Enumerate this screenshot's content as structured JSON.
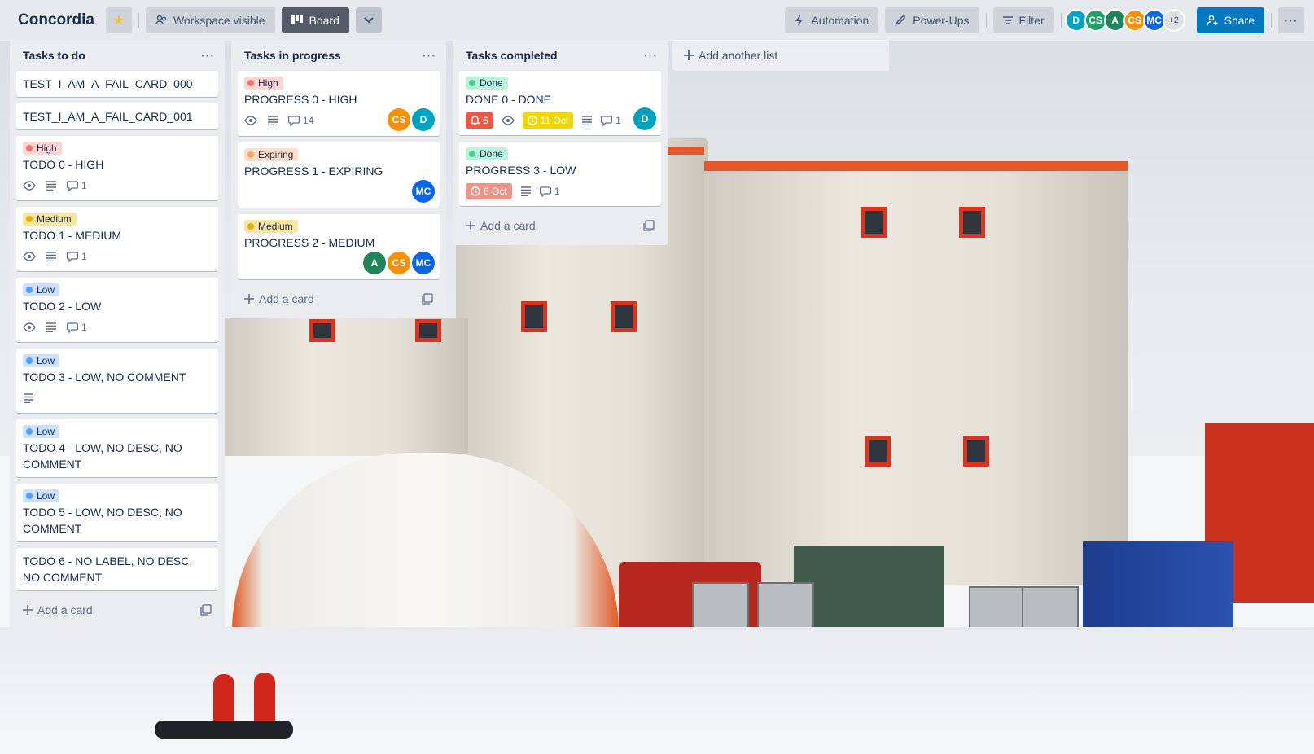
{
  "header": {
    "board_title": "Concordia",
    "workspace_visible": "Workspace visible",
    "board_view": "Board",
    "automation": "Automation",
    "power_ups": "Power-Ups",
    "filter": "Filter",
    "share": "Share",
    "members": [
      {
        "initials": "D",
        "color": "#00a3bf"
      },
      {
        "initials": "CS",
        "color": "#22a06b"
      },
      {
        "initials": "A",
        "color": "#1f845a"
      },
      {
        "initials": "CS",
        "color": "#f79009"
      },
      {
        "initials": "MC",
        "color": "#0c66e4"
      }
    ],
    "more_members": "+2"
  },
  "lists": [
    {
      "title": "Tasks to do",
      "add_card": "Add a card",
      "cards": [
        {
          "title": "TEST_I_AM_A_FAIL_CARD_000"
        },
        {
          "title": "TEST_I_AM_A_FAIL_CARD_001"
        },
        {
          "label": "High",
          "title": "TODO 0 - HIGH",
          "comments": "1"
        },
        {
          "label": "Medium",
          "title": "TODO 1 - MEDIUM",
          "comments": "1"
        },
        {
          "label": "Low",
          "title": "TODO 2 - LOW",
          "comments": "1"
        },
        {
          "label": "Low",
          "title": "TODO 3 - LOW, NO COMMENT"
        },
        {
          "label": "Low",
          "title": "TODO 4 - LOW, NO DESC, NO COMMENT"
        },
        {
          "label": "Low",
          "title": "TODO 5 - LOW, NO DESC, NO COMMENT"
        },
        {
          "title": "TODO 6 - NO LABEL, NO DESC, NO COMMENT"
        }
      ]
    },
    {
      "title": "Tasks in progress",
      "add_card": "Add a card",
      "cards": [
        {
          "label": "High",
          "title": "PROGRESS 0 - HIGH",
          "comments": "14",
          "members": [
            "CS",
            "D"
          ]
        },
        {
          "label": "Expiring",
          "title": "PROGRESS 1 - EXPIRING",
          "members": [
            "MC"
          ]
        },
        {
          "label": "Medium",
          "title": "PROGRESS 2 - MEDIUM",
          "members": [
            "A",
            "CS",
            "MC"
          ]
        }
      ]
    },
    {
      "title": "Tasks completed",
      "add_card": "Add a card",
      "cards": [
        {
          "label": "Done",
          "title": "DONE 0 - DONE",
          "notifications": "6",
          "due": "11 Oct",
          "comments": "1",
          "members": [
            "D"
          ]
        },
        {
          "label": "Done",
          "title": "PROGRESS 3 - LOW",
          "due": "6 Oct",
          "comments": "1"
        }
      ]
    }
  ],
  "add_list": "Add another list",
  "icons": {
    "star": "star-icon",
    "workspace": "people-icon",
    "board": "board-icon",
    "chevron": "chevron-down-icon",
    "automation": "lightning-icon",
    "power_ups": "rocket-icon",
    "filter": "filter-icon",
    "share": "add-person-icon",
    "more": "ellipsis-icon",
    "watch": "eye-icon",
    "description": "description-icon",
    "comment": "comment-icon",
    "clock": "clock-icon",
    "bell": "bell-icon",
    "plus": "plus-icon",
    "template": "template-icon"
  }
}
